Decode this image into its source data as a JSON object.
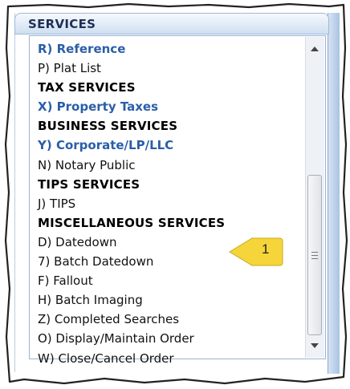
{
  "panel": {
    "title": "SERVICES"
  },
  "list": {
    "items": [
      {
        "label": "R) Reference",
        "kind": "link"
      },
      {
        "label": "P) Plat List",
        "kind": "normal"
      },
      {
        "label": "TAX SERVICES",
        "kind": "header"
      },
      {
        "label": "X) Property Taxes",
        "kind": "link"
      },
      {
        "label": "BUSINESS SERVICES",
        "kind": "header"
      },
      {
        "label": "Y) Corporate/LP/LLC",
        "kind": "link"
      },
      {
        "label": "N) Notary Public",
        "kind": "normal"
      },
      {
        "label": "TIPS SERVICES",
        "kind": "header"
      },
      {
        "label": "J) TIPS",
        "kind": "normal"
      },
      {
        "label": "MISCELLANEOUS SERVICES",
        "kind": "header"
      },
      {
        "label": "D) Datedown",
        "kind": "normal"
      },
      {
        "label": "7) Batch Datedown",
        "kind": "normal"
      },
      {
        "label": "F) Fallout",
        "kind": "normal"
      },
      {
        "label": "H) Batch Imaging",
        "kind": "normal"
      },
      {
        "label": "Z) Completed Searches",
        "kind": "normal"
      },
      {
        "label": "O) Display/Maintain Order",
        "kind": "normal"
      },
      {
        "label": "W) Close/Cancel Order",
        "kind": "normal"
      }
    ]
  },
  "callout": {
    "number": "1",
    "color": "#f5d53a"
  },
  "colors": {
    "link": "#2a5ea8",
    "header_text": "#1f2f55"
  }
}
